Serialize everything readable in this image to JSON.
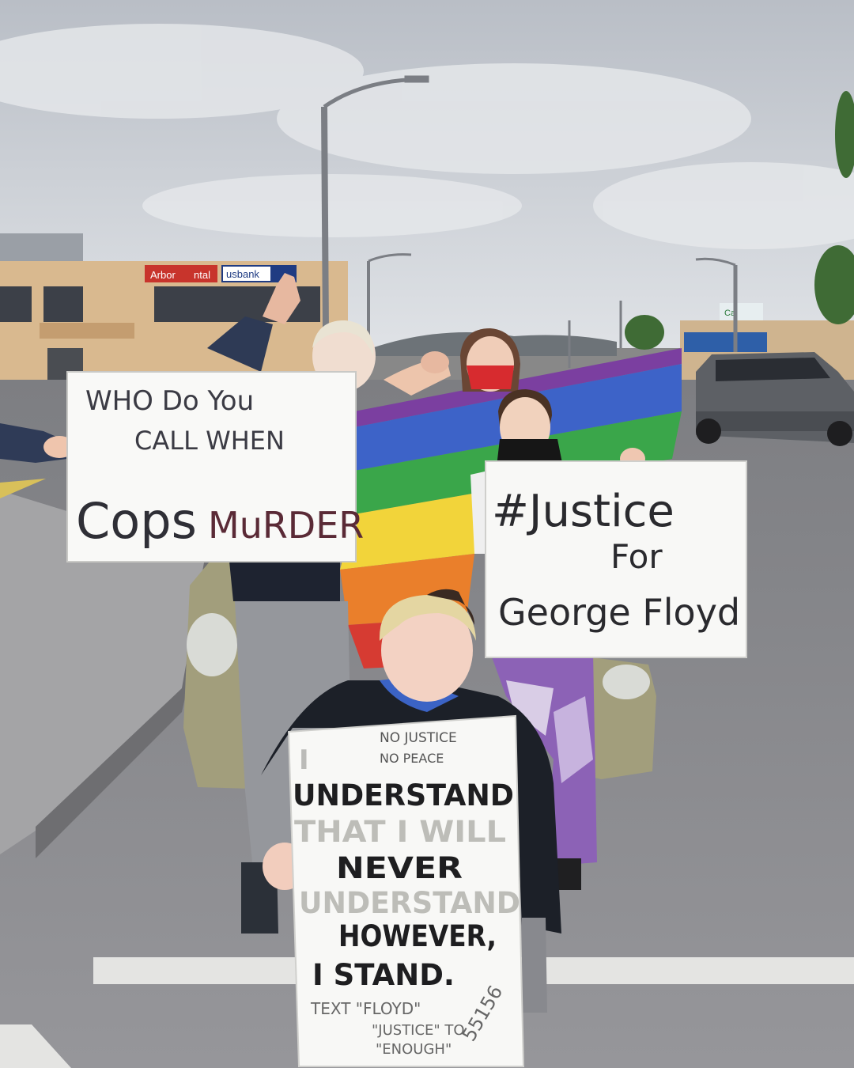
{
  "storefront": {
    "sign_arbor": "Arbor",
    "sign_arbor_suffix": "ntal",
    "sign_bank": "usbank",
    "sign_right": "Ca"
  },
  "sign_left": {
    "line1": "WHO Do You",
    "line2": "CALL WHEN",
    "line3a": "Cops",
    "line3b": "MuRDER"
  },
  "sign_right": {
    "line1": "#Justice",
    "line2": "For",
    "line3": "George Floyd"
  },
  "sign_bottom": {
    "top1": "NO JUSTICE",
    "top2": "NO PEACE",
    "line1": "I",
    "line2": "UNDERSTAND",
    "line3": "THAT I WILL",
    "line4": "NEVER",
    "line5": "UNDERSTAND",
    "line6": "HOWEVER,",
    "line7": "I STAND.",
    "small1": "TEXT \"FLOYD\"",
    "small2": "\"JUSTICE\" TO",
    "small3": "\"ENOUGH\"",
    "number": "55156"
  },
  "colors": {
    "sky": "#c9cdd3",
    "road": "#8a8a8c",
    "building": "#d9b98f",
    "flag_red": "#d63b32",
    "flag_orange": "#ea7f2b",
    "flag_yellow": "#f2d43a",
    "flag_green": "#3aa64a",
    "flag_blue": "#3d63c8",
    "flag_purple": "#7b3fa0"
  }
}
